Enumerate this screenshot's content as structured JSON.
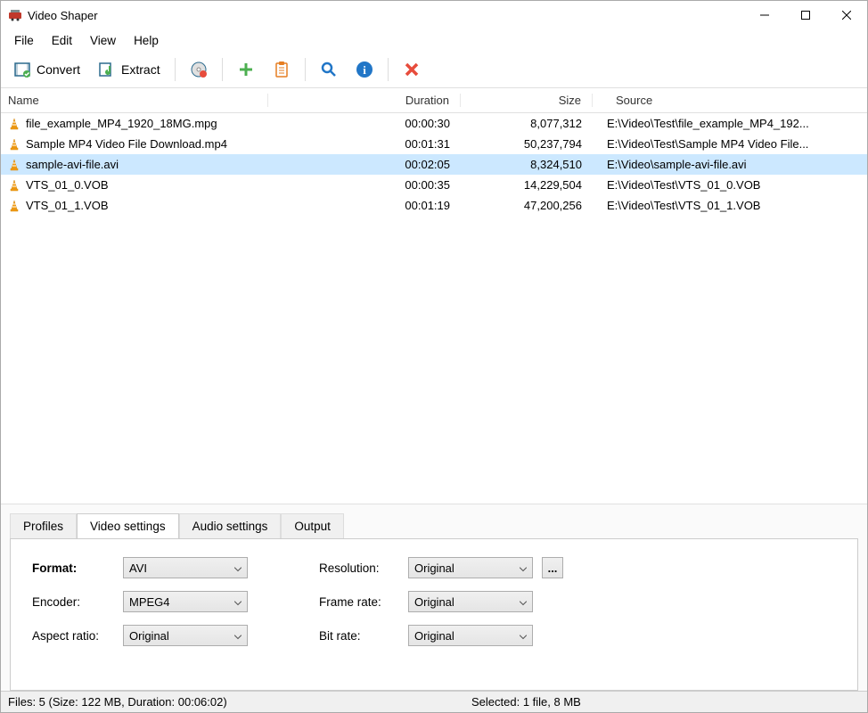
{
  "titlebar": {
    "title": "Video Shaper"
  },
  "menu": {
    "items": [
      "File",
      "Edit",
      "View",
      "Help"
    ]
  },
  "toolbar": {
    "convert": "Convert",
    "extract": "Extract"
  },
  "columns": {
    "name": "Name",
    "duration": "Duration",
    "size": "Size",
    "source": "Source"
  },
  "files": [
    {
      "name": "file_example_MP4_1920_18MG.mpg",
      "duration": "00:00:30",
      "size": "8,077,312",
      "source": "E:\\Video\\Test\\file_example_MP4_192...",
      "selected": false
    },
    {
      "name": "Sample MP4 Video File Download.mp4",
      "duration": "00:01:31",
      "size": "50,237,794",
      "source": "E:\\Video\\Test\\Sample MP4 Video File...",
      "selected": false
    },
    {
      "name": "sample-avi-file.avi",
      "duration": "00:02:05",
      "size": "8,324,510",
      "source": "E:\\Video\\sample-avi-file.avi",
      "selected": true
    },
    {
      "name": "VTS_01_0.VOB",
      "duration": "00:00:35",
      "size": "14,229,504",
      "source": "E:\\Video\\Test\\VTS_01_0.VOB",
      "selected": false
    },
    {
      "name": "VTS_01_1.VOB",
      "duration": "00:01:19",
      "size": "47,200,256",
      "source": "E:\\Video\\Test\\VTS_01_1.VOB",
      "selected": false
    }
  ],
  "tabs": {
    "items": [
      "Profiles",
      "Video settings",
      "Audio settings",
      "Output"
    ],
    "active": 1
  },
  "settings": {
    "format_label": "Format:",
    "format_value": "AVI",
    "encoder_label": "Encoder:",
    "encoder_value": "MPEG4",
    "aspect_label": "Aspect ratio:",
    "aspect_value": "Original",
    "resolution_label": "Resolution:",
    "resolution_value": "Original",
    "framerate_label": "Frame rate:",
    "framerate_value": "Original",
    "bitrate_label": "Bit rate:",
    "bitrate_value": "Original",
    "ellipsis": "..."
  },
  "status": {
    "left": "Files: 5 (Size: 122 MB, Duration: 00:06:02)",
    "right": "Selected: 1 file, 8 MB"
  }
}
